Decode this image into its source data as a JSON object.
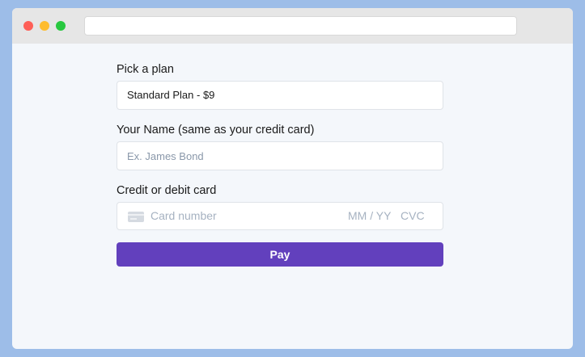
{
  "window": {
    "controls": {
      "close_color": "#fe5f57",
      "minimize_color": "#febc2e",
      "maximize_color": "#28c840"
    },
    "address_bar": ""
  },
  "form": {
    "plan": {
      "label": "Pick a plan",
      "value": "Standard Plan - $9"
    },
    "name": {
      "label": "Your Name (same as your credit card)",
      "placeholder": "Ex. James Bond",
      "value": ""
    },
    "card": {
      "label": "Credit or debit card",
      "icon": "credit-card-icon",
      "number_placeholder": "Card number",
      "expiry_placeholder": "MM / YY",
      "cvc_placeholder": "CVC"
    },
    "pay_label": "Pay"
  },
  "colors": {
    "accent": "#6240bd",
    "page_background": "#9dbde8",
    "window_background": "#f4f7fb"
  }
}
